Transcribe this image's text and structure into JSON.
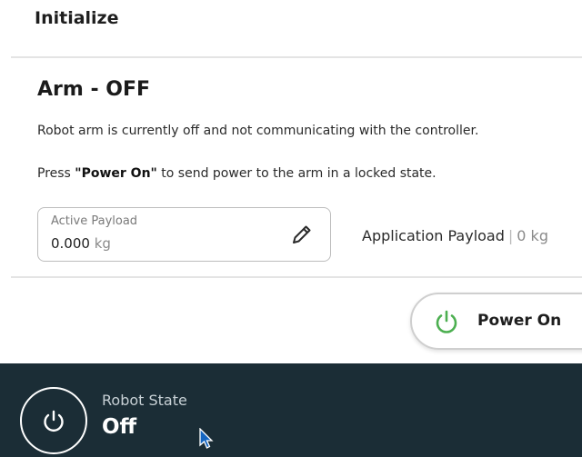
{
  "header": {
    "title": "Initialize"
  },
  "arm": {
    "title": "Arm - OFF",
    "status_text": "Robot arm is currently off and not communicating with the controller.",
    "instruction_prefix": "Press ",
    "instruction_bold": "\"Power On\"",
    "instruction_suffix": " to send power to the arm in a locked state."
  },
  "active_payload": {
    "label": "Active Payload",
    "value": "0.000",
    "unit": "kg",
    "edit_icon": "pencil-icon"
  },
  "application_payload": {
    "label": "Application Payload",
    "separator": "|",
    "value": "0 kg"
  },
  "power_on_button": {
    "label": "Power On",
    "icon": "power-icon",
    "icon_color": "#4caf50"
  },
  "footer": {
    "background": "#1b2d36",
    "label": "Robot State",
    "value": "Off",
    "icon": "power-icon"
  }
}
